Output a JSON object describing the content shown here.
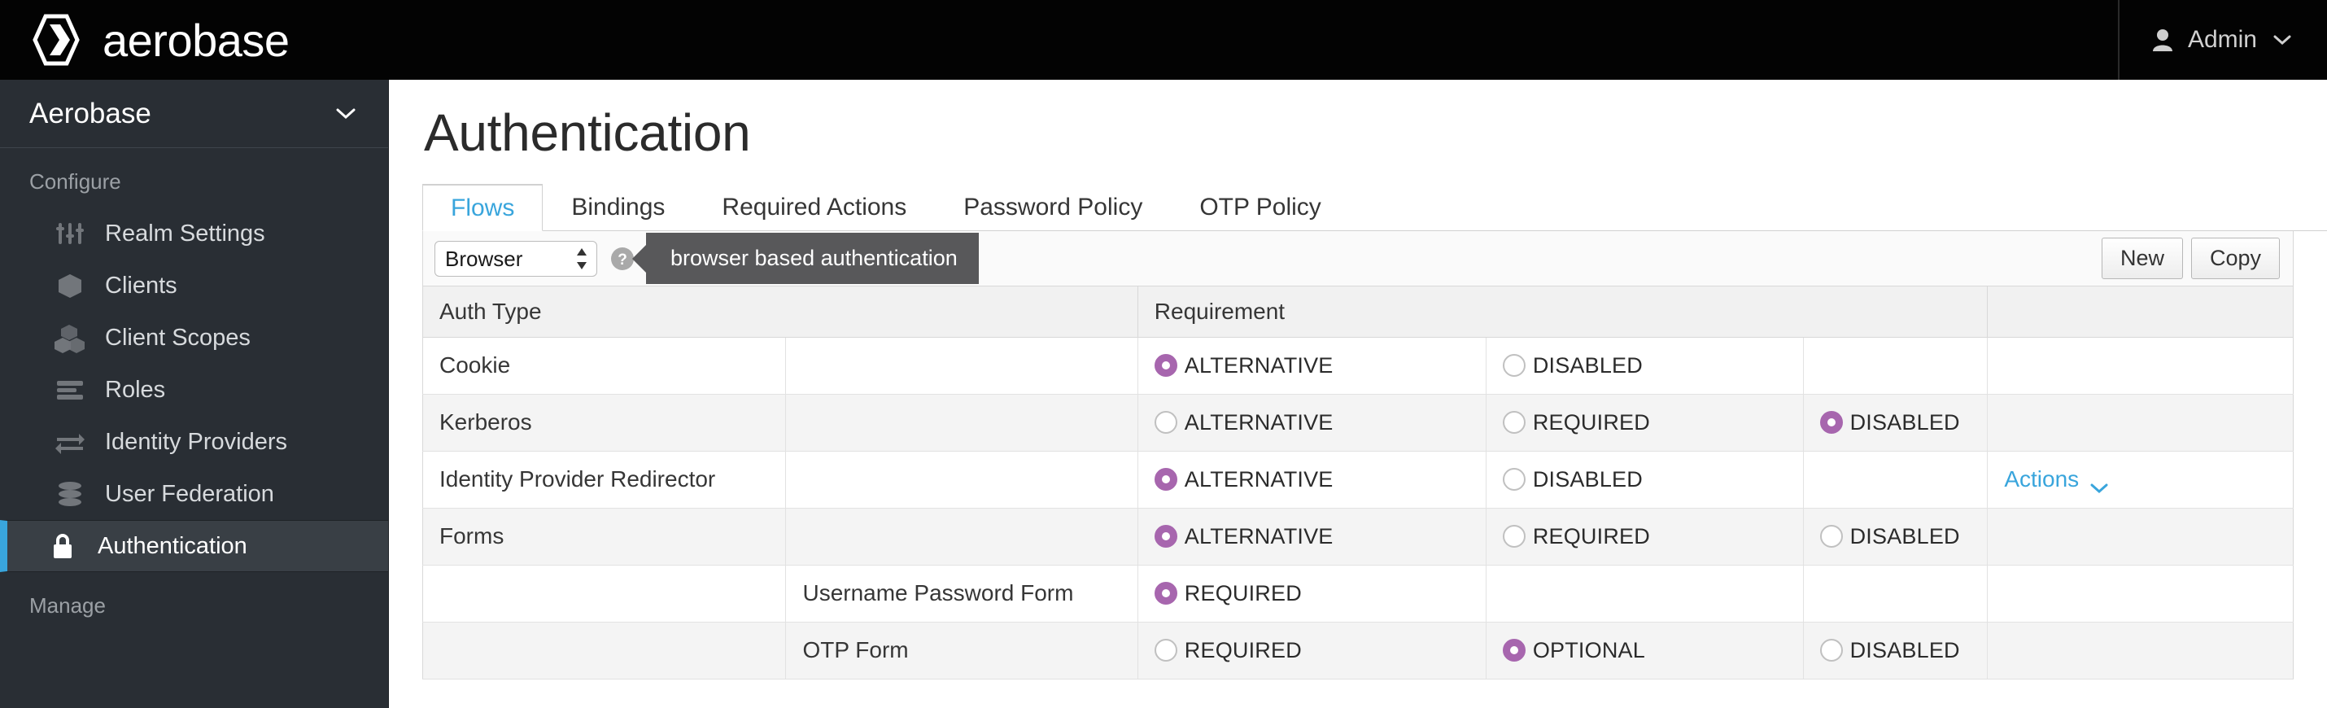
{
  "topbar": {
    "brand": "aerobase",
    "brand_logo_icon": "hexagon-chevron-logo",
    "user_icon": "user-icon",
    "user_label": "Admin",
    "user_caret_icon": "chevron-down-icon"
  },
  "sidebar": {
    "realm_label": "Aerobase",
    "realm_caret_icon": "chevron-down-icon",
    "section_configure": "Configure",
    "section_manage": "Manage",
    "items": [
      {
        "label": "Realm Settings",
        "icon": "sliders-icon",
        "active": false
      },
      {
        "label": "Clients",
        "icon": "cube-icon",
        "active": false
      },
      {
        "label": "Client Scopes",
        "icon": "cubes-icon",
        "active": false
      },
      {
        "label": "Roles",
        "icon": "list-bars-icon",
        "active": false
      },
      {
        "label": "Identity Providers",
        "icon": "exchange-arrows-icon",
        "active": false
      },
      {
        "label": "User Federation",
        "icon": "database-icon",
        "active": false
      },
      {
        "label": "Authentication",
        "icon": "lock-icon",
        "active": true
      }
    ]
  },
  "main": {
    "page_title": "Authentication",
    "tabs": [
      {
        "label": "Flows",
        "active": true
      },
      {
        "label": "Bindings",
        "active": false
      },
      {
        "label": "Required Actions",
        "active": false
      },
      {
        "label": "Password Policy",
        "active": false
      },
      {
        "label": "OTP Policy",
        "active": false
      }
    ],
    "toolbar": {
      "flow_select_value": "Browser",
      "flow_select_options": [
        "Browser"
      ],
      "help_icon": "question-circle-icon",
      "tooltip_text": "browser based authentication",
      "new_label": "New",
      "copy_label": "Copy"
    },
    "table": {
      "headers": [
        "Auth Type",
        "Requirement"
      ],
      "rows": [
        {
          "auth_type": "Cookie",
          "sub_type": "",
          "options": [
            {
              "label": "ALTERNATIVE",
              "selected": true
            },
            {
              "label": "DISABLED",
              "selected": false
            },
            {
              "label": "",
              "selected": false
            }
          ],
          "actions": ""
        },
        {
          "auth_type": "Kerberos",
          "sub_type": "",
          "options": [
            {
              "label": "ALTERNATIVE",
              "selected": false
            },
            {
              "label": "REQUIRED",
              "selected": false
            },
            {
              "label": "DISABLED",
              "selected": true
            }
          ],
          "actions": ""
        },
        {
          "auth_type": "Identity Provider Redirector",
          "sub_type": "",
          "options": [
            {
              "label": "ALTERNATIVE",
              "selected": true
            },
            {
              "label": "DISABLED",
              "selected": false
            },
            {
              "label": "",
              "selected": false
            }
          ],
          "actions": "Actions"
        },
        {
          "auth_type": "Forms",
          "sub_type": "",
          "options": [
            {
              "label": "ALTERNATIVE",
              "selected": true
            },
            {
              "label": "REQUIRED",
              "selected": false
            },
            {
              "label": "DISABLED",
              "selected": false
            }
          ],
          "actions": ""
        },
        {
          "auth_type": "",
          "sub_type": "Username Password Form",
          "options": [
            {
              "label": "REQUIRED",
              "selected": true
            },
            {
              "label": "",
              "selected": false
            },
            {
              "label": "",
              "selected": false
            }
          ],
          "actions": ""
        },
        {
          "auth_type": "",
          "sub_type": "OTP Form",
          "options": [
            {
              "label": "REQUIRED",
              "selected": false
            },
            {
              "label": "OPTIONAL",
              "selected": true
            },
            {
              "label": "DISABLED",
              "selected": false
            }
          ],
          "actions": ""
        }
      ],
      "actions_caret_icon": "chevron-down-icon"
    }
  },
  "colors": {
    "accent_blue": "#39a5dc",
    "radio_selected": "#a766ae",
    "sidebar_bg": "#292e34",
    "topbar_bg": "#030303",
    "tooltip_bg": "#58585a"
  }
}
